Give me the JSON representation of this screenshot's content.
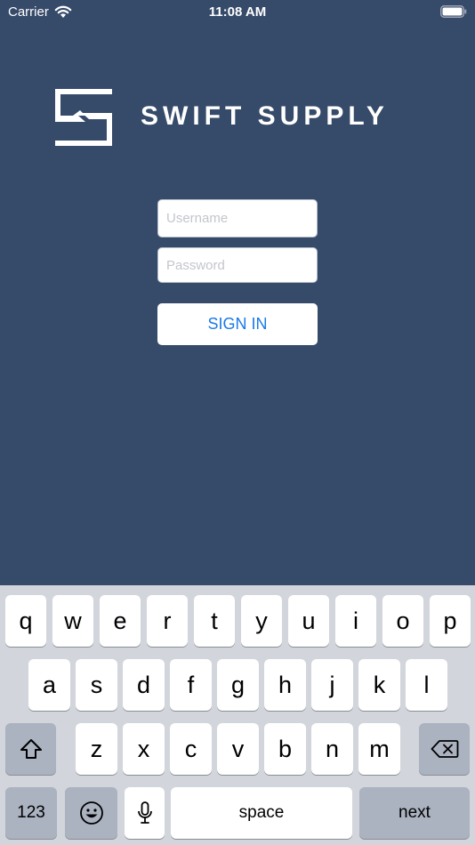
{
  "status_bar": {
    "carrier": "Carrier",
    "time": "11:08 AM"
  },
  "logo": {
    "text": "SWIFT SUPPLY"
  },
  "login": {
    "username_placeholder": "Username",
    "password_placeholder": "Password",
    "sign_in_label": "SIGN IN"
  },
  "colors": {
    "background": "#364a6a",
    "accent": "#1a7ae8",
    "keyboard": "#d2d5db"
  },
  "keyboard": {
    "row1": [
      "q",
      "w",
      "e",
      "r",
      "t",
      "y",
      "u",
      "i",
      "o",
      "p"
    ],
    "row2": [
      "a",
      "s",
      "d",
      "f",
      "g",
      "h",
      "j",
      "k",
      "l"
    ],
    "row3": [
      "z",
      "x",
      "c",
      "v",
      "b",
      "n",
      "m"
    ],
    "numbers_label": "123",
    "space_label": "space",
    "next_label": "next",
    "icons": [
      "shift-icon",
      "backspace-icon",
      "emoji-icon",
      "microphone-icon"
    ]
  }
}
